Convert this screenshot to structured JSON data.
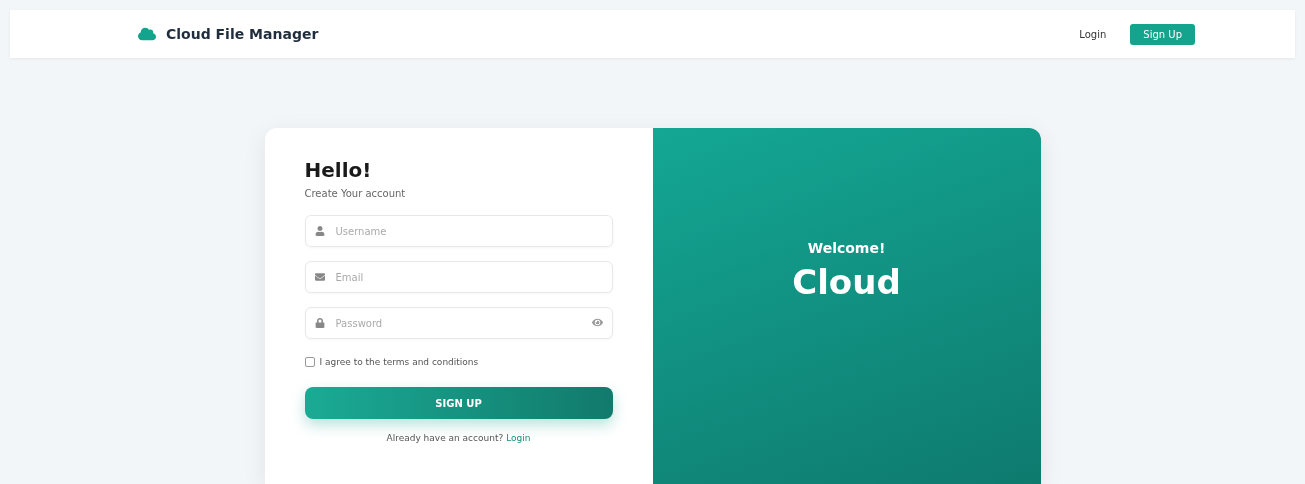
{
  "header": {
    "brand": "Cloud File Manager",
    "login": "Login",
    "signup": "Sign Up"
  },
  "form": {
    "title": "Hello!",
    "subtitle": "Create Your account",
    "fields": [
      {
        "kind": "user",
        "placeholder": "Username"
      },
      {
        "kind": "email",
        "placeholder": "Email"
      },
      {
        "kind": "password",
        "placeholder": "Password"
      }
    ],
    "terms": {
      "label": "I agree to the terms and conditions",
      "checked": false
    },
    "submit": "SIGN UP",
    "prompt": "Already have an account?",
    "link": "Login"
  },
  "welcome": {
    "greeting": "Welcome!",
    "headline": "Cloud"
  }
}
